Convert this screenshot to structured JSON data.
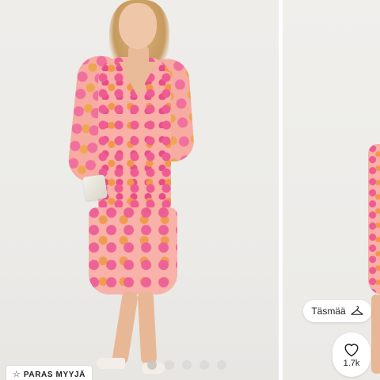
{
  "badge": {
    "label": "PARAS MYYJÄ",
    "icon": "star-outline-icon"
  },
  "match_button": {
    "label": "Täsmää",
    "icon": "hanger-icon"
  },
  "like_button": {
    "count": "1.7k",
    "icon": "heart-outline-icon"
  },
  "carousel": {
    "dot_count": 5,
    "active_index": 0
  },
  "colors": {
    "dress_pink": "#f9b0a6",
    "print_magenta": "#ee5c93",
    "print_orange": "#f19848",
    "background": "#eeedea"
  }
}
